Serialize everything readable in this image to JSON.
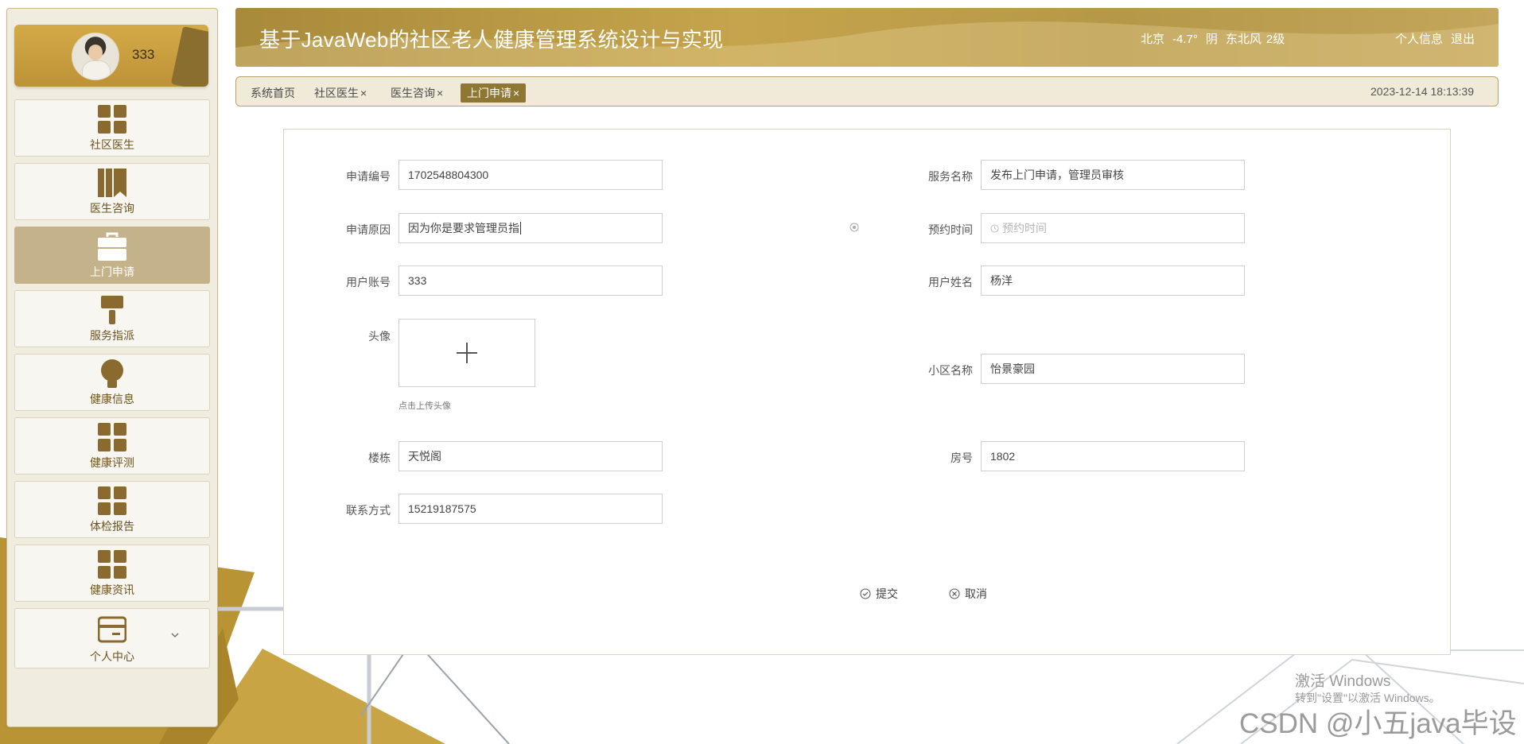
{
  "app": {
    "title": "基于JavaWeb的社区老人健康管理系统设计与实现",
    "weather": {
      "city": "北京",
      "temp": "-4.7°",
      "condition": "阴",
      "wind": "东北风",
      "level": "2级"
    },
    "links": {
      "profile": "个人信息",
      "logout": "退出"
    }
  },
  "user": {
    "name": "333"
  },
  "sidebar": {
    "items": [
      {
        "label": "社区医生",
        "icon": "grid-icon"
      },
      {
        "label": "医生咨询",
        "icon": "books-icon"
      },
      {
        "label": "上门申请",
        "icon": "briefcase-icon",
        "active": true
      },
      {
        "label": "服务指派",
        "icon": "brush-icon"
      },
      {
        "label": "健康信息",
        "icon": "bulb-icon"
      },
      {
        "label": "健康评测",
        "icon": "grid-icon"
      },
      {
        "label": "体检报告",
        "icon": "grid-icon"
      },
      {
        "label": "健康资讯",
        "icon": "grid-icon"
      },
      {
        "label": "个人中心",
        "icon": "card-icon",
        "has_submenu": true
      }
    ]
  },
  "tabs": {
    "items": [
      {
        "label": "系统首页",
        "close": ""
      },
      {
        "label": "社区医生",
        "close": "×"
      },
      {
        "label": "医生咨询",
        "close": "×"
      },
      {
        "label": "上门申请",
        "close": "×",
        "active": true
      }
    ],
    "datetime": "2023-12-14 18:13:39"
  },
  "form": {
    "apply_no": {
      "label": "申请编号",
      "value": "1702548804300"
    },
    "service_name": {
      "label": "服务名称",
      "value": "发布上门申请，管理员审核"
    },
    "reason": {
      "label": "申请原因",
      "value": "因为你是要求管理员指"
    },
    "appointment": {
      "label": "预约时间",
      "value": "",
      "placeholder": "预约时间"
    },
    "account": {
      "label": "用户账号",
      "value": "333"
    },
    "username": {
      "label": "用户姓名",
      "value": "杨洋"
    },
    "avatar": {
      "label": "头像",
      "hint": "点击上传头像"
    },
    "community": {
      "label": "小区名称",
      "value": "怡景豪园"
    },
    "building": {
      "label": "楼栋",
      "value": "天悦阁"
    },
    "room": {
      "label": "房号",
      "value": "1802"
    },
    "phone": {
      "label": "联系方式",
      "value": "15219187575"
    },
    "submit": "提交",
    "cancel": "取消"
  },
  "watermarks": {
    "activate_title": "激活 Windows",
    "activate_sub": "转到\"设置\"以激活 Windows。",
    "csdn": "CSDN @小五java毕设"
  },
  "colors": {
    "accent": "#8e7633",
    "header": "#c6a44c",
    "active_menu": "#c4b38a",
    "icon": "#8a6a2e"
  }
}
